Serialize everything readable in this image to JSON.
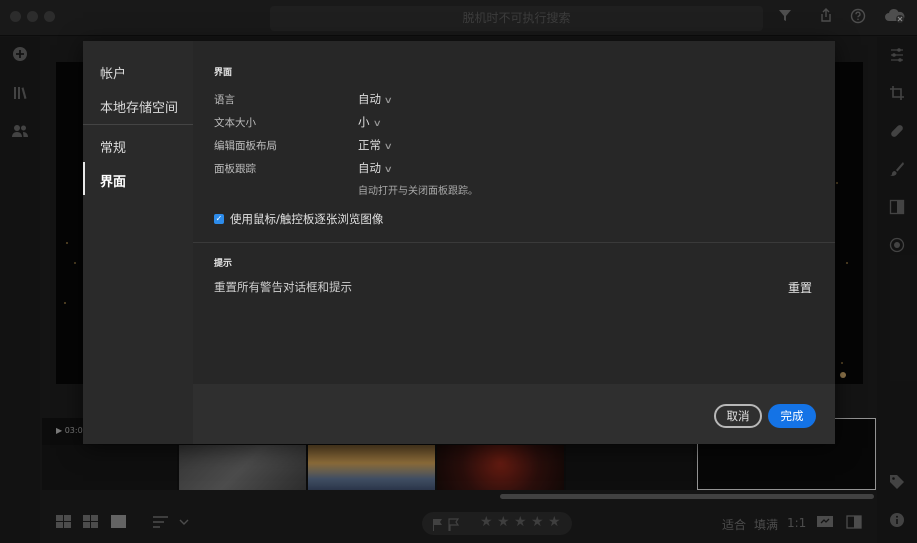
{
  "titlebar": {
    "search_placeholder": "脱机时不可执行搜索"
  },
  "modal": {
    "nav": {
      "account": "帐户",
      "local_storage": "本地存储空间",
      "general": "常规",
      "interface": "界面"
    },
    "interface_section": {
      "title": "界面",
      "language_label": "语言",
      "language_value": "自动",
      "text_size_label": "文本大小",
      "text_size_value": "小",
      "panel_layout_label": "编辑面板布局",
      "panel_layout_value": "正常",
      "panel_tracking_label": "面板跟踪",
      "panel_tracking_value": "自动",
      "panel_tracking_help": "自动打开与关闭面板跟踪。",
      "scroll_checkbox_label": "使用鼠标/触控板逐张浏览图像",
      "scroll_checkbox_checked": true
    },
    "tips_section": {
      "title": "提示",
      "reset_text": "重置所有警告对话框和提示",
      "reset_button": "重置"
    },
    "buttons": {
      "cancel": "取消",
      "done": "完成"
    }
  },
  "filmstrip": {
    "video_label": "▶ 03:0"
  },
  "bottombar": {
    "fit": "适合",
    "fill": "填满",
    "ratio": "1:1",
    "rating_stars": 0
  },
  "colors": {
    "accent": "#1473e6",
    "checkbox": "#2d8ceb"
  }
}
